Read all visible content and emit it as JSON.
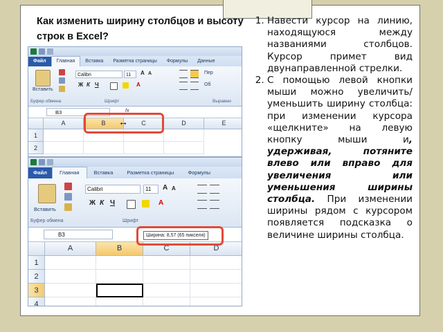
{
  "slide": {
    "title": "Как изменить ширину столбцов и высоту\nстрок в Excel?",
    "steps": [
      {
        "text": "Навести курсор на линию, находящуюся между названиями столбцов. Курсор примет вид двунаправленной стрелки."
      },
      {
        "text_before": "С помощью левой кнопки мыши можно увеличить/уменьшить ширину столбца: при изменении курсора «щелкните» на левую кнопку мыши и",
        "text_emphasis": ", удерживая, потяните влево или вправо для увеличения или уменьшения ширины столбца.",
        "text_after": " При изменении ширины рядом с курсором появляется подсказка о величине ширины столбца."
      }
    ]
  },
  "excel1": {
    "tabs": [
      "Файл",
      "Главная",
      "Вставка",
      "Разметка страницы",
      "Формулы",
      "Данные"
    ],
    "font_name": "Calibri",
    "font_size": "11",
    "bold_btn": "Ж",
    "italic_btn": "К",
    "underline_btn": "Ч",
    "paste_label": "Вставить",
    "group_clipboard": "Буфер обмена",
    "group_font": "Шрифт",
    "group_align": "Выравни",
    "wrap_label": "Пер",
    "merge_label": "Об",
    "name_box": "B3",
    "fx_label": "fx",
    "columns": [
      "A",
      "B",
      "C",
      "D",
      "E"
    ],
    "rows": [
      "1",
      "2"
    ],
    "cursor_glyph": "↔"
  },
  "excel2": {
    "tabs": [
      "Файл",
      "Главная",
      "Вставка",
      "Разметка страницы",
      "Формулы"
    ],
    "font_name": "Calibri",
    "font_size": "11",
    "bold_btn": "Ж",
    "italic_btn": "К",
    "underline_btn": "Ч",
    "paste_label": "Вставить",
    "group_clipboard": "Буфер обмена",
    "group_font": "Шрифт",
    "name_box": "B3",
    "tooltip": "Ширина: 8,57 (65 пикселя)",
    "columns": [
      "A",
      "B",
      "C",
      "D"
    ],
    "rows": [
      "1",
      "2",
      "3",
      "4"
    ]
  },
  "colors": {
    "background": "#d6d1ac",
    "highlight_box": "#e04a3a",
    "file_tab": "#2a5aa8"
  }
}
